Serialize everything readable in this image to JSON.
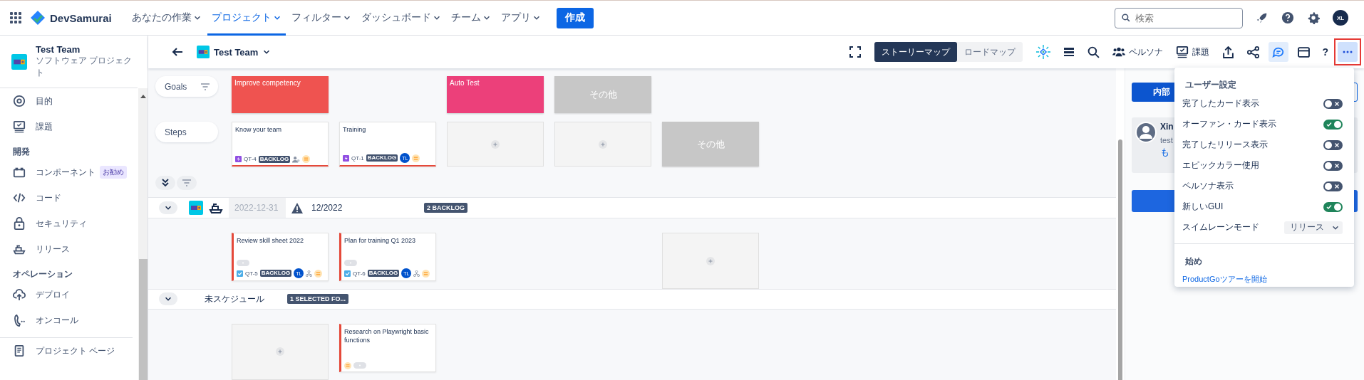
{
  "topnav": {
    "logo": "DevSamurai",
    "menu": [
      {
        "label": "あなたの作業",
        "selected": false
      },
      {
        "label": "プロジェクト",
        "selected": true
      },
      {
        "label": "フィルター",
        "selected": false
      },
      {
        "label": "ダッシュボード",
        "selected": false
      },
      {
        "label": "チーム",
        "selected": false
      },
      {
        "label": "アプリ",
        "selected": false
      }
    ],
    "create": "作成",
    "search": {
      "placeholder": "検索"
    },
    "avatar": "XL"
  },
  "sidebar": {
    "project": {
      "name": "Test Team",
      "type": "ソフトウェア プロジェクト"
    },
    "sections": [
      {
        "items": [
          {
            "label": "目的"
          },
          {
            "label": "課題"
          }
        ]
      },
      {
        "heading": "開発",
        "items": [
          {
            "label": "コンポーネント",
            "badge": "お勧め"
          },
          {
            "label": "コード"
          },
          {
            "label": "セキュリティ"
          },
          {
            "label": "リリース"
          }
        ]
      },
      {
        "heading": "オペレーション",
        "items": [
          {
            "label": "デプロイ"
          },
          {
            "label": "オンコール"
          }
        ]
      }
    ],
    "footer": {
      "label": "プロジェクト ページ"
    }
  },
  "toolbar": {
    "project": "Test Team",
    "views": [
      {
        "label": "ストーリーマップ",
        "selected": true
      },
      {
        "label": "ロードマップ",
        "selected": false
      }
    ],
    "persona": "ペルソナ",
    "issues": "課題",
    "chat_active": true,
    "help": "?",
    "more": {
      "open": true,
      "highlighted": true
    }
  },
  "map": {
    "goals_label": "Goals",
    "steps_label": "Steps",
    "goals": [
      {
        "kind": "goal",
        "title": "Improve competency",
        "color": "#ef5350",
        "steps": [
          {
            "kind": "epic",
            "title": "Know your team",
            "key": "QT-4",
            "status": "BACKLOG"
          },
          {
            "kind": "epic",
            "title": "Training",
            "key": "QT-1",
            "status": "BACKLOG",
            "assignee": "TL"
          }
        ]
      },
      {
        "kind": "goal",
        "title": "Auto Test",
        "color": "#ec407a",
        "steps": [
          {
            "kind": "empty"
          }
        ]
      },
      {
        "kind": "others",
        "title": "その他",
        "steps": [
          {
            "kind": "empty"
          },
          {
            "kind": "others",
            "title": "その他"
          }
        ]
      }
    ],
    "lanes": [
      {
        "kind": "release",
        "expanded": true,
        "date": "2022-12-31",
        "warning": true,
        "name": "12/2022",
        "badge": "2 BACKLOG",
        "cells": [
          {
            "kind": "task",
            "title": "Review skill sheet 2022",
            "key": "QT-5",
            "status": "BACKLOG",
            "assignee": "TL",
            "subtasks": true
          },
          {
            "kind": "task",
            "title": "Plan for training Q1 2023",
            "key": "QT-6",
            "status": "BACKLOG",
            "assignee": "TL",
            "subtasks": true
          },
          null,
          null,
          {
            "kind": "empty"
          }
        ]
      },
      {
        "kind": "unscheduled",
        "expanded": true,
        "name": "未スケジュール",
        "badge": "1 SELECTED FO...",
        "cells": [
          {
            "kind": "empty"
          },
          {
            "kind": "task",
            "title": "Research on Playwright basic functions",
            "subtasks": true
          }
        ]
      }
    ]
  },
  "panel": {
    "button": "内部",
    "comment": {
      "author": "Xin",
      "text": "test",
      "link": "も"
    }
  },
  "menu": {
    "heading": "ユーザー設定",
    "toggles": [
      {
        "label": "完了したカード表示",
        "on": false
      },
      {
        "label": "オーファン・カード表示",
        "on": true
      },
      {
        "label": "完了したリリース表示",
        "on": false
      },
      {
        "label": "エピックカラー使用",
        "on": false
      },
      {
        "label": "ペルソナ表示",
        "on": false
      },
      {
        "label": "新しいGUI",
        "on": true
      }
    ],
    "select": {
      "label": "スイムレーンモード",
      "value": "リリース"
    },
    "section": "始め",
    "link": "ProductGoツアーを開始"
  }
}
